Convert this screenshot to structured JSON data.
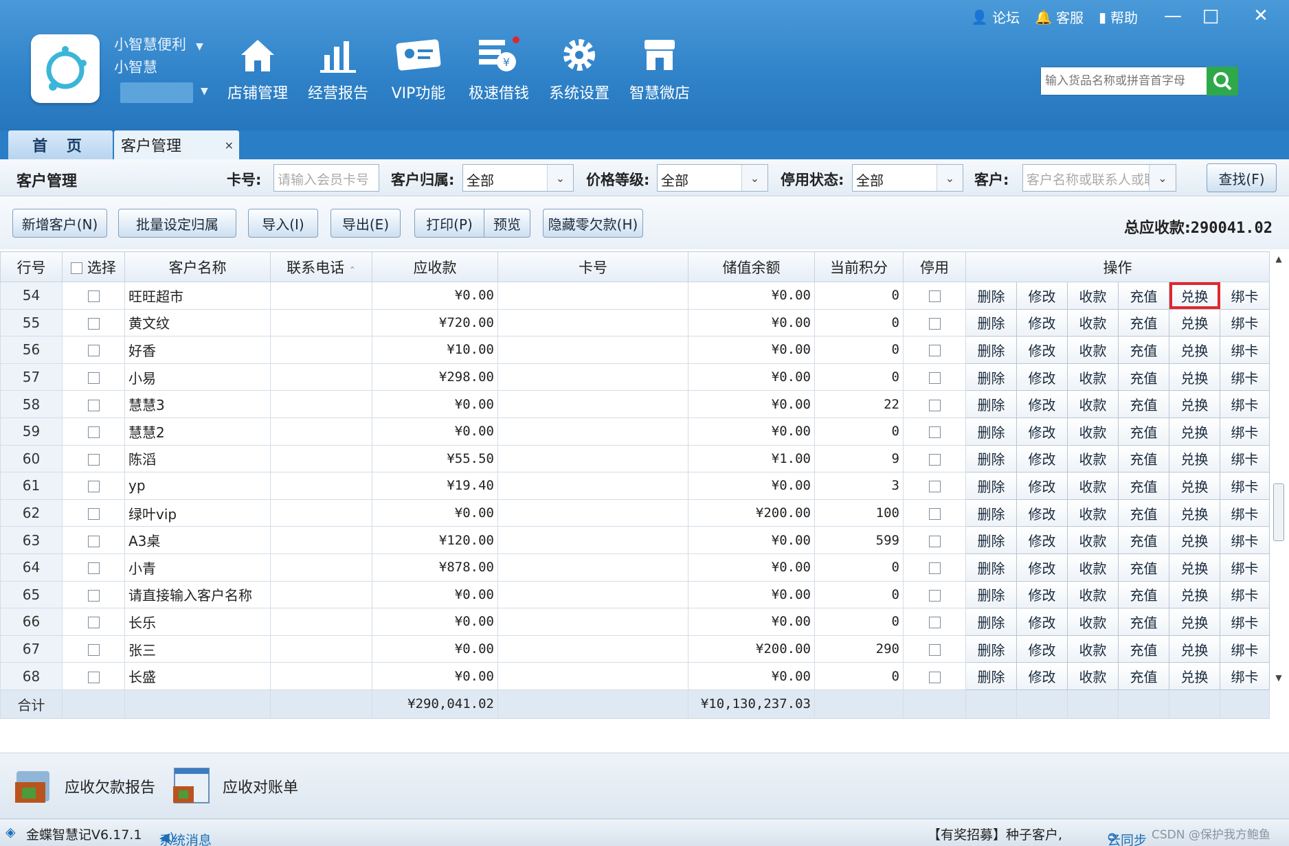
{
  "header": {
    "store_name": "小智慧便利",
    "user_name": "小智慧",
    "top_links": [
      "论坛",
      "客服",
      "帮助"
    ],
    "nav": [
      "店铺管理",
      "经营报告",
      "VIP功能",
      "极速借钱",
      "系统设置",
      "智慧微店"
    ],
    "search_placeholder": "输入货品名称或拼音首字母"
  },
  "tabs": {
    "home": "首 页",
    "customer": "客户管理",
    "close": "×"
  },
  "filter": {
    "title": "客户管理",
    "card_label": "卡号:",
    "card_placeholder": "请输入会员卡号",
    "owner_label": "客户归属:",
    "owner_value": "全部",
    "price_label": "价格等级:",
    "price_value": "全部",
    "status_label": "停用状态:",
    "status_value": "全部",
    "customer_label": "客户:",
    "customer_placeholder": "客户名称或联系人或联系电话",
    "search_button": "查找(F)"
  },
  "toolbar": {
    "add": "新增客户(N)",
    "batch": "批量设定归属",
    "import": "导入(I)",
    "export": "导出(E)",
    "print": "打印(P)",
    "preview": "预览",
    "hide_zero": "隐藏零欠款(H)",
    "total_label": "总应收款:",
    "total_value": "290041.02"
  },
  "table": {
    "headers": [
      "行号",
      "选择",
      "客户名称",
      "联系电话",
      "应收款",
      "卡号",
      "储值余额",
      "当前积分",
      "停用",
      "操作"
    ],
    "ops": [
      "删除",
      "修改",
      "收款",
      "充值",
      "兑换",
      "绑卡"
    ],
    "rows": [
      {
        "no": "54",
        "name": "旺旺超市",
        "phone": "",
        "recv": "¥0.00",
        "card": "",
        "balance": "¥0.00",
        "points": "0"
      },
      {
        "no": "55",
        "name": "黄文纹",
        "phone": "",
        "recv": "¥720.00",
        "card": "",
        "balance": "¥0.00",
        "points": "0"
      },
      {
        "no": "56",
        "name": "好香",
        "phone": "",
        "recv": "¥10.00",
        "card": "",
        "balance": "¥0.00",
        "points": "0"
      },
      {
        "no": "57",
        "name": "小易",
        "phone": "",
        "recv": "¥298.00",
        "card": "",
        "balance": "¥0.00",
        "points": "0"
      },
      {
        "no": "58",
        "name": "慧慧3",
        "phone": "",
        "recv": "¥0.00",
        "card": "",
        "balance": "¥0.00",
        "points": "22"
      },
      {
        "no": "59",
        "name": "慧慧2",
        "phone": "",
        "recv": "¥0.00",
        "card": "",
        "balance": "¥0.00",
        "points": "0"
      },
      {
        "no": "60",
        "name": "陈滔",
        "phone": "",
        "recv": "¥55.50",
        "card": "",
        "balance": "¥1.00",
        "points": "9"
      },
      {
        "no": "61",
        "name": "yp",
        "phone": "",
        "recv": "¥19.40",
        "card": "",
        "balance": "¥0.00",
        "points": "3"
      },
      {
        "no": "62",
        "name": "绿叶vip",
        "phone": "",
        "recv": "¥0.00",
        "card": "",
        "balance": "¥200.00",
        "points": "100"
      },
      {
        "no": "63",
        "name": "A3桌",
        "phone": "",
        "recv": "¥120.00",
        "card": "",
        "balance": "¥0.00",
        "points": "599"
      },
      {
        "no": "64",
        "name": "小青",
        "phone": "",
        "recv": "¥878.00",
        "card": "",
        "balance": "¥0.00",
        "points": "0"
      },
      {
        "no": "65",
        "name": "请直接输入客户名称",
        "phone": "",
        "recv": "¥0.00",
        "card": "",
        "balance": "¥0.00",
        "points": "0"
      },
      {
        "no": "66",
        "name": "长乐",
        "phone": "",
        "recv": "¥0.00",
        "card": "",
        "balance": "¥0.00",
        "points": "0"
      },
      {
        "no": "67",
        "name": "张三",
        "phone": "",
        "recv": "¥0.00",
        "card": "",
        "balance": "¥200.00",
        "points": "290"
      },
      {
        "no": "68",
        "name": "长盛",
        "phone": "",
        "recv": "¥0.00",
        "card": "",
        "balance": "¥0.00",
        "points": "0"
      }
    ],
    "summary": {
      "label": "合计",
      "recv": "¥290,041.02",
      "balance": "¥10,130,237.03"
    },
    "highlight_color": "#e0262c"
  },
  "bottom": {
    "report1": "应收欠款报告",
    "report2": "应收对账单"
  },
  "status": {
    "app": "金蝶智慧记V6.17.1",
    "sysmsg": "系统消息",
    "promo": "【有奖招募】种子客户,",
    "sync": "云同步",
    "watermark": "CSDN @保护我方鲍鱼"
  }
}
